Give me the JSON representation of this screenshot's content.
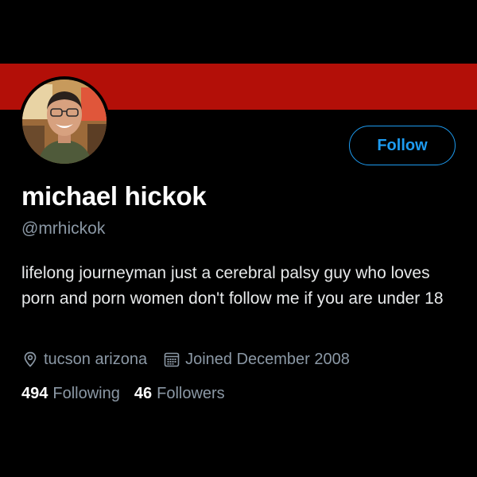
{
  "profile": {
    "display_name": "michael hickok",
    "handle": "@mrhickok",
    "bio": "lifelong journeyman just a cerebral palsy guy who loves porn and porn women don't follow me if you are under 18",
    "location": "tucson arizona",
    "joined": "Joined December 2008",
    "banner_color": "#b30f08",
    "avatar_icon": "profile-photo",
    "location_icon": "location-pin-icon",
    "calendar_icon": "calendar-icon"
  },
  "actions": {
    "follow_label": "Follow",
    "accent_color": "#1d9bf0"
  },
  "stats": {
    "following_count": "494",
    "following_label": "Following",
    "followers_count": "46",
    "followers_label": "Followers"
  }
}
